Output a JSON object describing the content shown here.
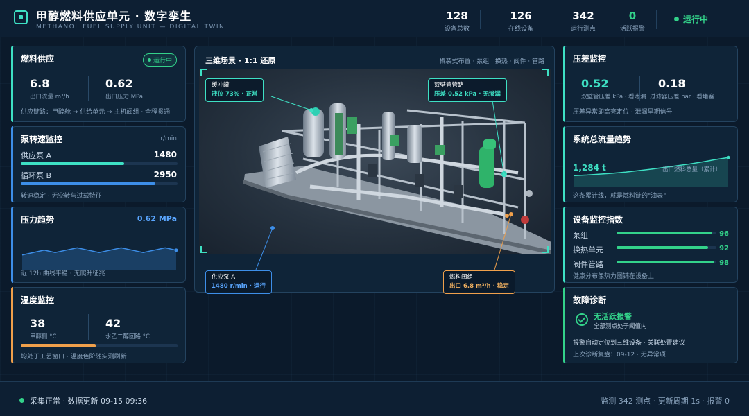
{
  "header": {
    "title": "甲醇燃料供应单元 · 数字孪生",
    "subtitle": "METHANOL FUEL SUPPLY UNIT — DIGITAL TWIN",
    "stats": [
      {
        "value": "128",
        "label": "设备总数"
      },
      {
        "value": "126",
        "label": "在线设备"
      },
      {
        "value": "342",
        "label": "运行测点"
      },
      {
        "value": "0",
        "label": "活跃报警"
      }
    ],
    "status": "运行中"
  },
  "fuel_supply": {
    "title": "燃料供应",
    "badge": "运行中",
    "flow_value": "6.8",
    "flow_label": "出口流量 m³/h",
    "pressure_value": "0.62",
    "pressure_label": "出口压力 MPa",
    "chain": "供应链路：甲醇舱 → 供给单元 → 主机阀组 · 全程贯通"
  },
  "pump_speed": {
    "title": "泵转速监控",
    "unit": "r/min",
    "pumps": [
      {
        "name": "供应泵 A",
        "value": "1480",
        "fraction": 0.66
      },
      {
        "name": "循环泵 B",
        "value": "2950",
        "fraction": 0.86
      }
    ],
    "note": "转速稳定 · 无空转与过载特征"
  },
  "pressure_trend": {
    "title": "压力趋势",
    "current": "0.62 MPa",
    "note": "近 12h 曲线平稳 · 无爬升征兆",
    "series": [
      0.6,
      0.61,
      0.62,
      0.61,
      0.62,
      0.63,
      0.62,
      0.61,
      0.62,
      0.63,
      0.62,
      0.61,
      0.62,
      0.63,
      0.62
    ]
  },
  "temperature": {
    "title": "温度监控",
    "methanol_value": "38",
    "methanol_label": "甲醇侧 °C",
    "glycol_value": "42",
    "glycol_label": "水乙二醇回路 °C",
    "bar_fraction": 0.48,
    "note": "均处于工艺窗口 · 温度色阶随实测刷新"
  },
  "scene": {
    "title": "三维场景 · 1:1 还原",
    "meta": "橇装式布置 · 泵组 · 换热 · 阀件 · 管路",
    "callouts": {
      "buffer_tank": {
        "name": "缓冲罐",
        "detail": "液位 73% · 正常"
      },
      "double_wall": {
        "name": "双壁管管路",
        "detail": "压差 0.52 kPa · 无渗漏"
      },
      "supply_pump": {
        "name": "供应泵 A",
        "detail": "1480 r/min · 运行"
      },
      "fuel_valve": {
        "name": "燃料阀组",
        "detail": "出口 6.8 m³/h · 稳定"
      }
    }
  },
  "diff_pressure": {
    "title": "压差监控",
    "dw_value": "0.52",
    "dw_label": "双壁管压差 kPa · 看泄漏",
    "filter_value": "0.18",
    "filter_label": "过滤器压差 bar · 看堵塞",
    "note": "压差异常即高亮定位 · 泄漏早期信号"
  },
  "total_flow": {
    "title": "系统总流量趋势",
    "value": "1,284 t",
    "label": "出口燃料总量（累计）",
    "note": "这条累计线，就是燃料链的\"油表\"",
    "series": [
      0.28,
      0.3,
      0.33,
      0.36,
      0.4,
      0.45,
      0.5,
      0.56,
      0.62,
      0.68,
      0.75,
      0.83,
      0.9
    ]
  },
  "health_index": {
    "title": "设备监控指数",
    "items": [
      {
        "name": "泵组",
        "value": "96",
        "fraction": 0.96
      },
      {
        "name": "换热单元",
        "value": "92",
        "fraction": 0.92
      },
      {
        "name": "阀件管路",
        "value": "98",
        "fraction": 0.98
      }
    ],
    "note": "健康分布像热力图铺在设备上"
  },
  "diagnosis": {
    "title": "故障诊断",
    "headline": "无活跃报警",
    "sub": "全部测点处于阈值内",
    "line1": "报警自动定位到三维设备 · 关联处置建议",
    "line2": "上次诊断复盘：09-12 · 无异常项"
  },
  "footer": {
    "left": "采集正常 · 数据更新 09-15 09:36",
    "right": "监测 342 测点 · 更新周期 1s · 报警 0"
  },
  "colors": {
    "accent_teal": "#3ee0c4",
    "accent_blue": "#3d8ee8",
    "accent_orange": "#f0a04b",
    "ok_green": "#33d28a",
    "background": "#0b1a2b"
  }
}
